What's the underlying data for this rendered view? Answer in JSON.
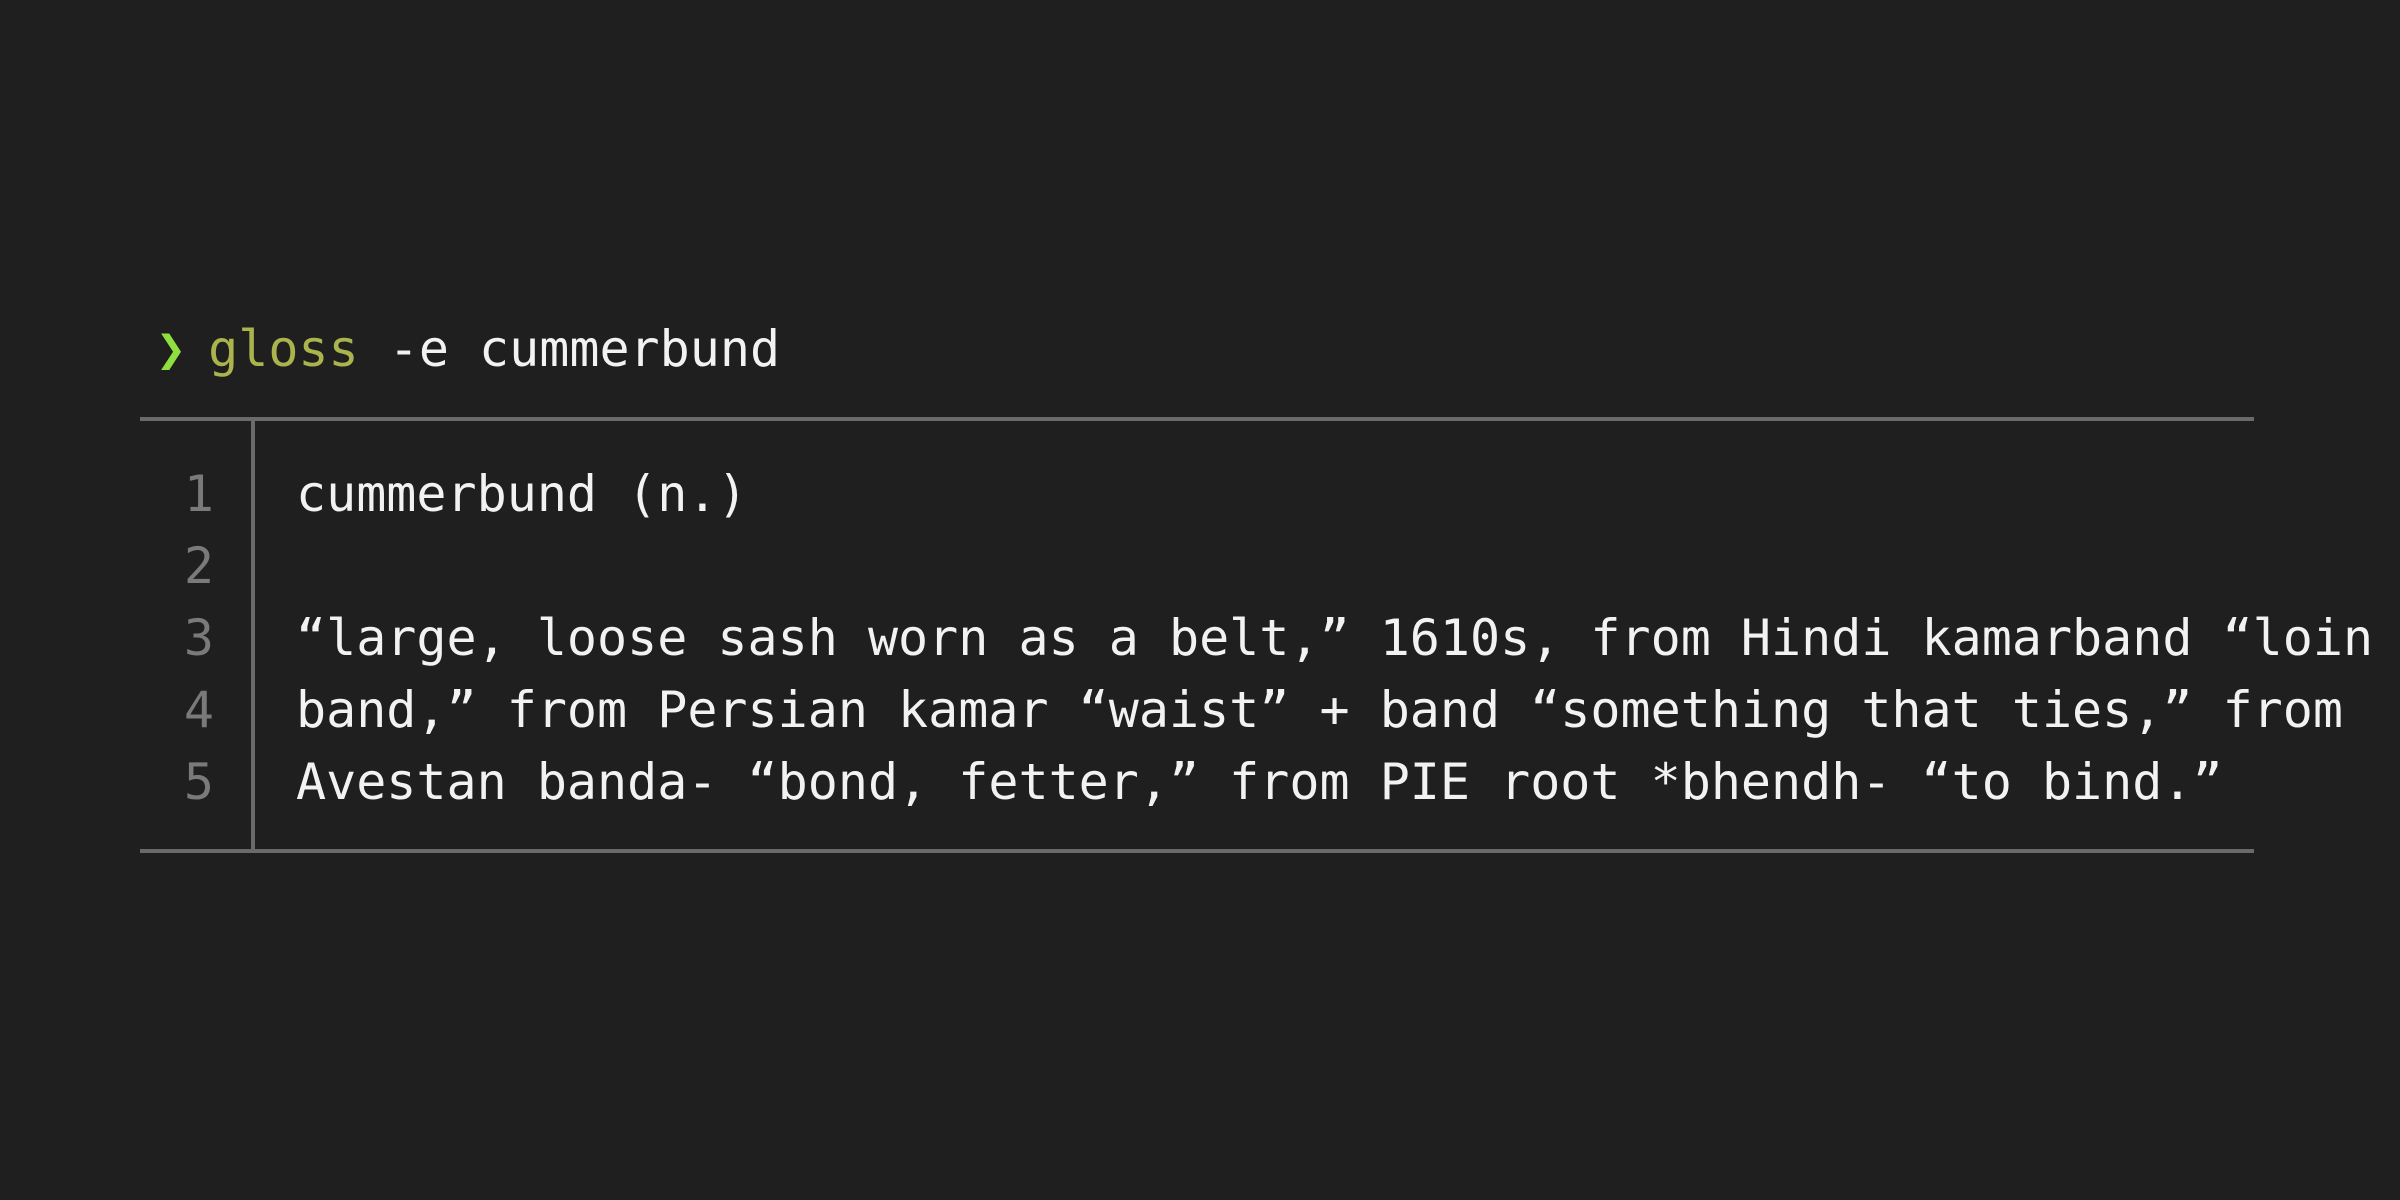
{
  "colors": {
    "background": "#1f1f1f",
    "prompt_symbol": "#8fe03f",
    "command": "#aab34c",
    "text": "#f2f2f2",
    "line_numbers": "#7a7a7a",
    "rules": "#6a6a6a"
  },
  "prompt": {
    "symbol": "❯",
    "symbol_icon": "chevron-right-icon",
    "command": "gloss",
    "args": " -e cummerbund"
  },
  "output": {
    "line_numbers": [
      "1",
      "2",
      "3",
      "4",
      "5"
    ],
    "lines": [
      "cummerbund (n.)",
      "",
      "“large, loose sash worn as a belt,” 1610s, from Hindi kamarband “loin",
      "band,” from Persian kamar “waist” + band “something that ties,” from",
      "Avestan banda- “bond, fetter,” from PIE root *bhendh- “to bind.”"
    ]
  }
}
